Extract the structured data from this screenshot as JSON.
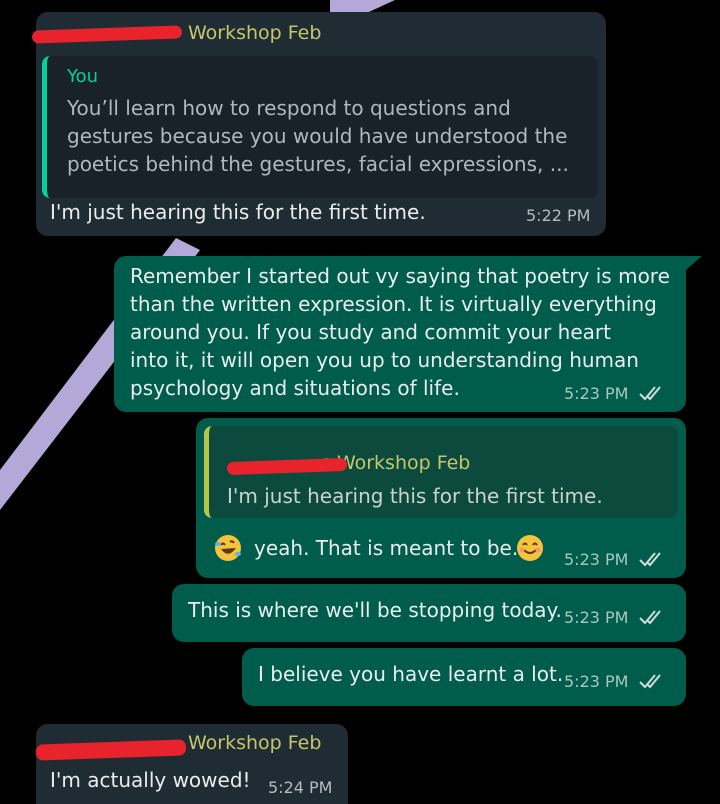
{
  "conversation": {
    "msg1": {
      "sender": "Workshop Feb",
      "quote_author": "You",
      "quote_lines": [
        "You’ll learn how to respond to questions and",
        "gestures because you would have understood the",
        "poetics behind the gestures,  facial expressions, ..."
      ],
      "text": "I'm just hearing this for the first time.",
      "time": "5:22 PM"
    },
    "msg2": {
      "lines": [
        "Remember I started out vy saying that poetry is more",
        "than the written expression. It is virtually everything",
        "around you. If you study and commit your heart",
        "into it,  it will open you up to understanding human",
        "psychology and situations of life."
      ],
      "time": "5:23 PM",
      "status_icon": "double-check-read"
    },
    "msg3": {
      "quote_author": "s Workshop Feb",
      "quote_text": "I'm just hearing this for the first time.",
      "text": "yeah. That is meant to be.",
      "leading_emoji": "rolling-on-floor-laughing-emoji",
      "trailing_emoji": "smiling-face-emoji",
      "time": "5:23 PM",
      "status_icon": "double-check-read"
    },
    "msg4": {
      "text": "This is where we'll be stopping today.",
      "time": "5:23 PM",
      "status_icon": "double-check-read"
    },
    "msg5": {
      "text": "I believe you have learnt a lot.",
      "time": "5:23 PM",
      "status_icon": "double-check-read"
    },
    "msg6": {
      "sender": "Workshop Feb",
      "text": "I'm actually wowed!",
      "time": "5:24 PM"
    }
  },
  "colors": {
    "background": "#000000",
    "incoming_bubble": "#202c33",
    "outgoing_bubble": "#005c4b",
    "sender_name": "#c5c76a",
    "redaction": "#e8232c",
    "wallpaper_stroke": "#b4a8d8"
  }
}
